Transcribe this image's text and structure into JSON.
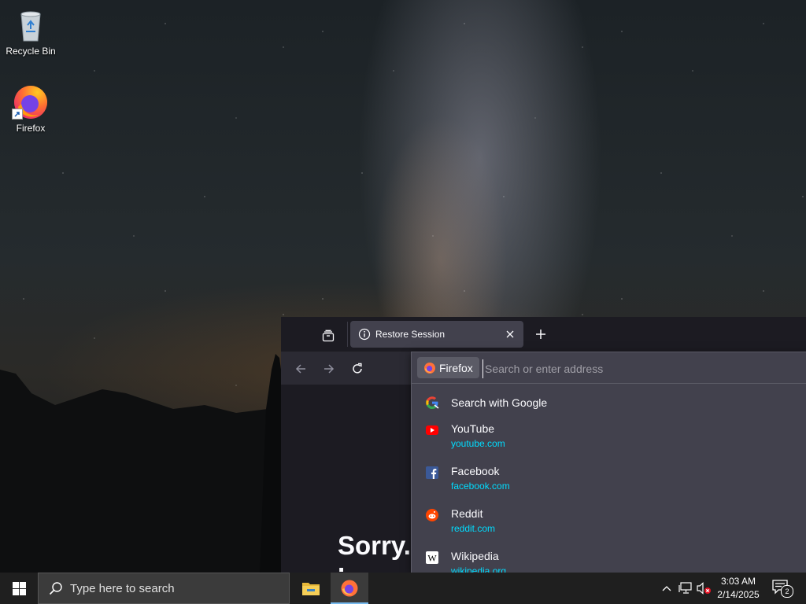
{
  "desktop": {
    "icons": [
      {
        "label": "Recycle Bin",
        "icon": "recycle-bin-icon"
      },
      {
        "label": "Firefox",
        "icon": "firefox-icon"
      }
    ]
  },
  "browser": {
    "tab": {
      "title": "Restore Session",
      "icon": "info-icon"
    },
    "new_tab_icon": "plus-icon",
    "content": {
      "heading": "Sorry.",
      "heading_line2": "L..."
    },
    "urlbar": {
      "engine_label": "Firefox",
      "placeholder": "Search or enter address",
      "results": [
        {
          "title": "Search with Google",
          "url": "",
          "icon": "google-icon"
        },
        {
          "title": "YouTube",
          "url": "youtube.com",
          "icon": "youtube-icon"
        },
        {
          "title": "Facebook",
          "url": "facebook.com",
          "icon": "facebook-icon"
        },
        {
          "title": "Reddit",
          "url": "reddit.com",
          "icon": "reddit-icon"
        },
        {
          "title": "Wikipedia",
          "url": "wikipedia.org",
          "icon": "wikipedia-icon"
        }
      ]
    }
  },
  "taskbar": {
    "search_placeholder": "Type here to search",
    "clock_time": "3:03 AM",
    "clock_date": "2/14/2025",
    "notification_count": "2"
  },
  "colors": {
    "accent_url": "#00ddff",
    "panel": "#42414d",
    "taskbar": "#1f1f1f"
  }
}
